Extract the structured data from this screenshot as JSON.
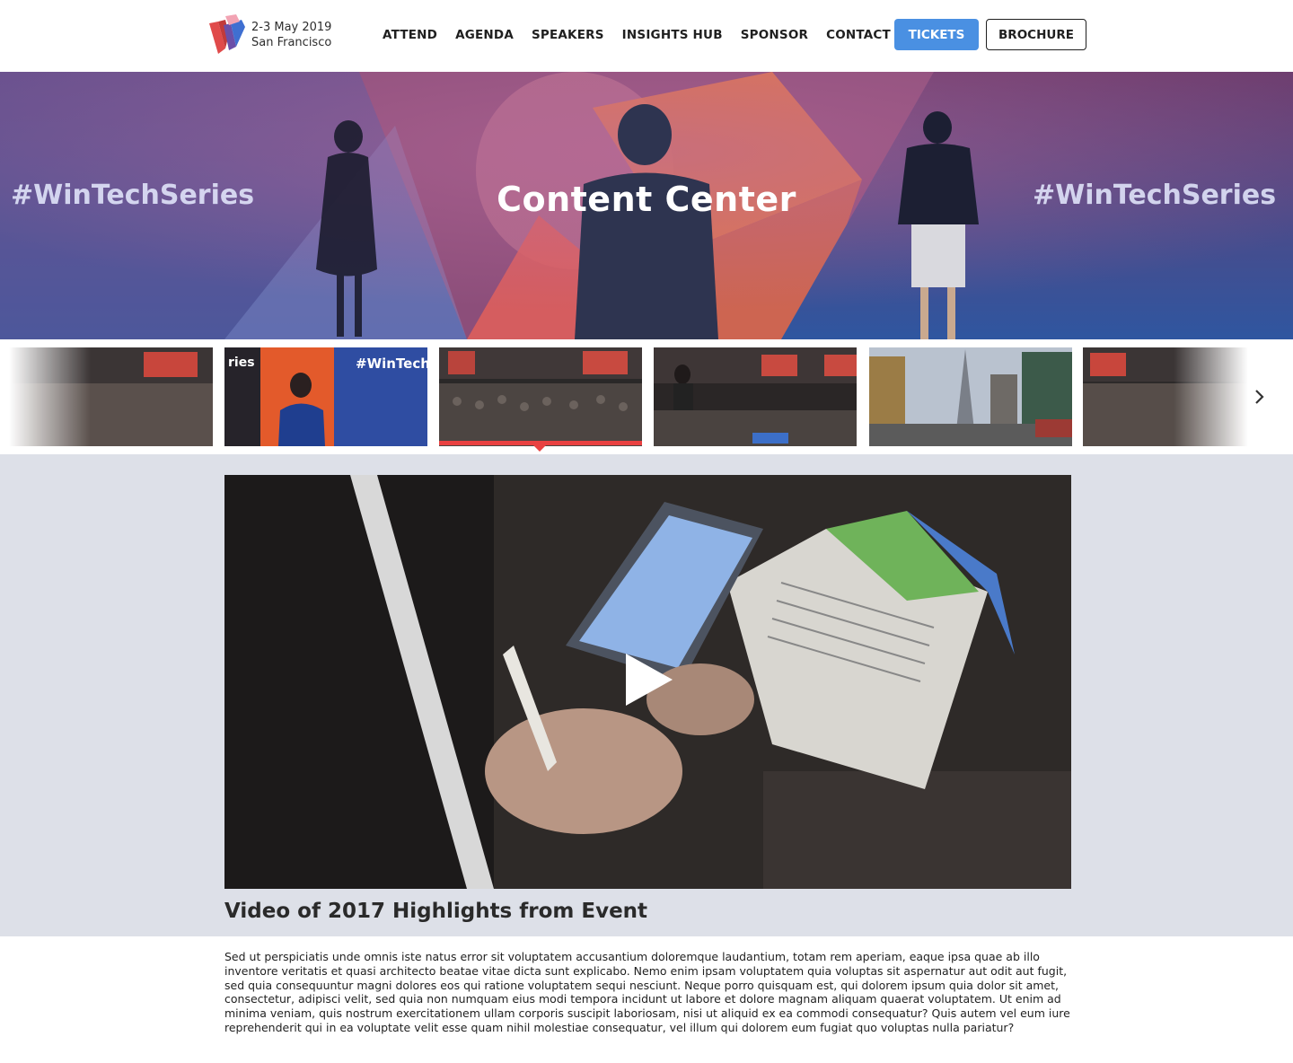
{
  "header": {
    "event_date": "2-3 May 2019",
    "event_city": "San Francisco",
    "nav": [
      "ATTEND",
      "AGENDA",
      "SPEAKERS",
      "INSIGHTS HUB",
      "SPONSOR",
      "CONTACT"
    ],
    "tickets_label": "TICKETS",
    "brochure_label": "BROCHURE"
  },
  "hero": {
    "title": "Content Center",
    "hashtag_left": "#WinTechSeries",
    "hashtag_right": "#WinTechSeries"
  },
  "carousel": {
    "prev_icon": "chevron-left-icon",
    "next_icon": "chevron-right-icon",
    "thumb_text": "#WinTech",
    "thumb_text_partial": "ries",
    "active_index": 2
  },
  "video": {
    "title": "Video of 2017 Highlights from Event",
    "description": "Sed ut perspiciatis unde omnis iste natus error sit voluptatem accusantium doloremque laudantium, totam rem aperiam, eaque ipsa quae ab illo inventore veritatis et quasi architecto beatae vitae dicta sunt explicabo. Nemo enim ipsam voluptatem quia voluptas sit aspernatur aut odit aut fugit, sed quia consequuntur magni dolores eos qui ratione voluptatem sequi nesciunt. Neque porro quisquam est, qui dolorem ipsum quia dolor sit amet, consectetur, adipisci velit, sed quia non numquam eius modi tempora incidunt ut labore et dolore magnam aliquam quaerat voluptatem. Ut enim ad minima veniam, quis nostrum exercitationem ullam corporis suscipit laboriosam, nisi ut aliquid ex ea commodi consequatur? Quis autem vel eum iure reprehenderit qui in ea voluptate velit esse quam nihil molestiae consequatur, vel illum qui dolorem eum fugiat quo voluptas nulla pariatur?"
  },
  "colors": {
    "accent_blue": "#4a90e2",
    "active_red": "#e94141",
    "section_bg": "#dde0e8"
  }
}
